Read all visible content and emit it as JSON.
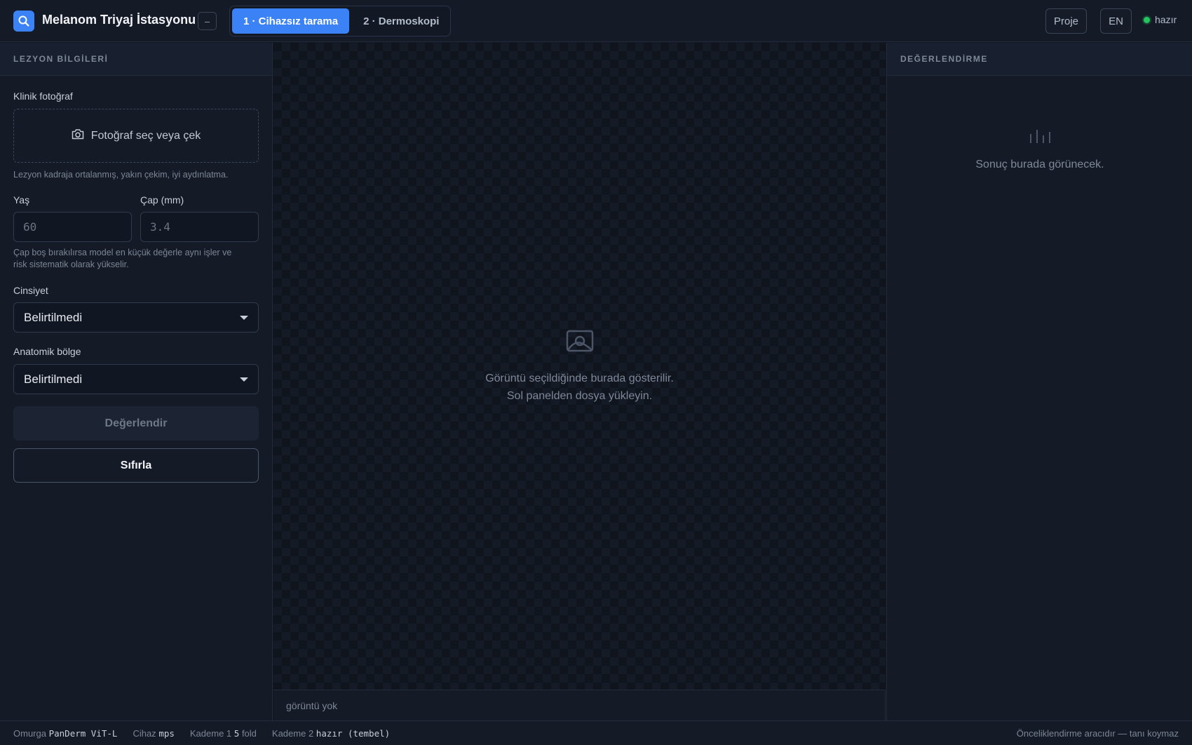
{
  "app": {
    "title": "Melanom Triyaj İstasyonu",
    "collapse_label": "–"
  },
  "tabs": [
    {
      "label": "1 · Cihazsız tarama",
      "active": true
    },
    {
      "label": "2 · Dermoskopi",
      "active": false
    }
  ],
  "header_right": {
    "project_label": "Proje",
    "language_label": "EN",
    "status_text": "hazır"
  },
  "left_panel": {
    "title": "LEZYON BİLGİLERİ",
    "photo_label": "Klinik fotoğraf",
    "upload_label": "Fotoğraf seç veya çek",
    "photo_hint": "Lezyon kadraja ortalanmış, yakın çekim, iyi aydınlatma.",
    "age_label": "Yaş",
    "age_placeholder": "60",
    "diameter_label": "Çap (mm)",
    "diameter_placeholder": "3.4",
    "diameter_hint_line1": "Çap boş bırakılırsa model en küçük değerle aynı işler ve",
    "diameter_hint_line2": "risk sistematik olarak yükselir.",
    "sex_label": "Cinsiyet",
    "sex_value": "Belirtilmedi",
    "region_label": "Anatomik bölge",
    "region_value": "Belirtilmedi",
    "evaluate_button": "Değerlendir",
    "reset_button": "Sıfırla"
  },
  "viewer": {
    "placeholder_line1": "Görüntü seçildiğinde burada gösterilir.",
    "placeholder_line2": "Sol panelden dosya yükleyin.",
    "footer_text": "görüntü yok"
  },
  "right_panel": {
    "title": "DEĞERLENDİRME",
    "empty_text": "Sonuç burada görünecek."
  },
  "statusbar": {
    "backbone_label": "Omurga",
    "backbone_value": "PanDerm ViT-L",
    "device_label": "Cihaz",
    "device_value": "mps",
    "stage1_label": "Kademe 1",
    "stage1_value": "5",
    "stage1_suffix": "fold",
    "stage2_label": "Kademe 2",
    "stage2_value": "hazır (tembel)",
    "disclaimer": "Önceliklendirme aracıdır — tanı koymaz"
  },
  "colors": {
    "accent": "#3b82f6",
    "status_ok": "#22c55e",
    "background": "#111722",
    "panel": "#141b27"
  },
  "icons": {
    "logo": "search-icon",
    "upload": "camera-icon",
    "viewer_placeholder": "image-icon",
    "result_placeholder": "bar-chart-icon",
    "select": "chevron-down-icon"
  }
}
